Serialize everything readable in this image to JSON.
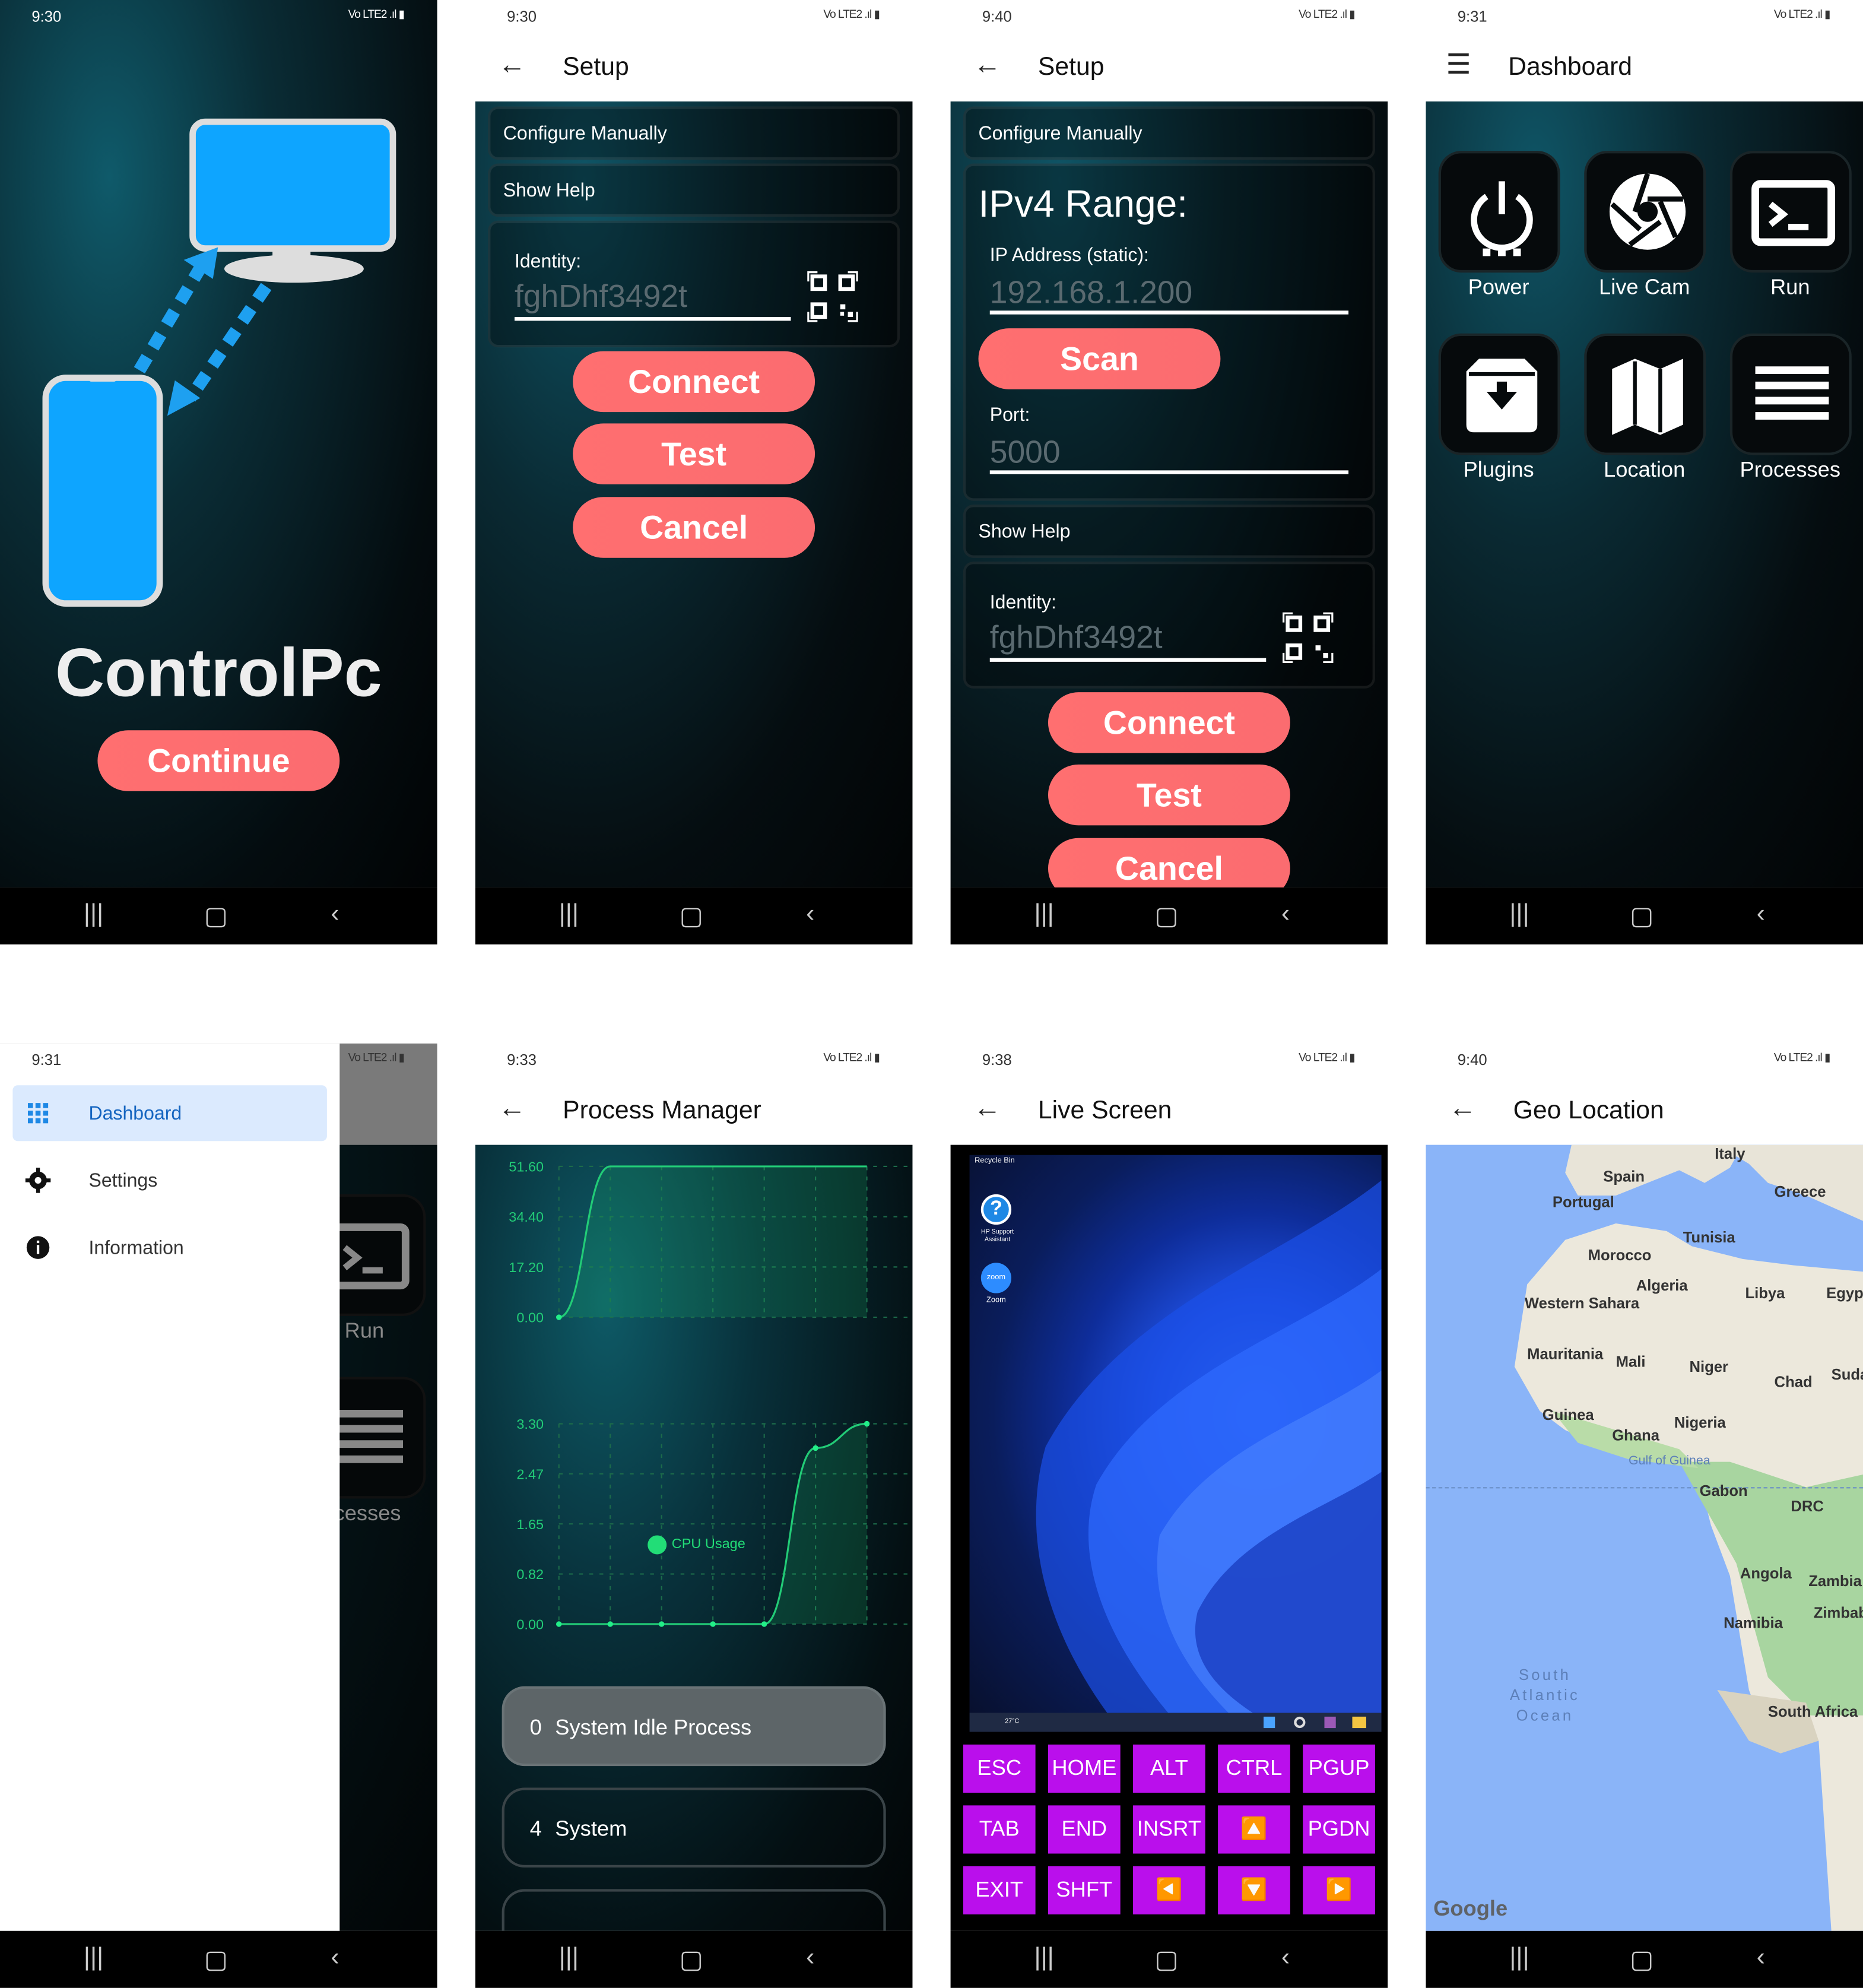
{
  "status_bar": {
    "icons": "Vo LTE2 .ıl ▮",
    "times": [
      "9:30",
      "9:30",
      "9:40",
      "9:31",
      "9:31",
      "9:33",
      "9:38",
      "9:40"
    ]
  },
  "nav_bar": {
    "recent": "|||",
    "home": "▢",
    "back": "‹"
  },
  "splash": {
    "app_name": "ControlPc",
    "continue_label": "Continue",
    "colors": {
      "device_blue": "#0ea5ff",
      "button": "#fb6c70"
    }
  },
  "setup": {
    "title": "Setup",
    "configure_manually": "Configure Manually",
    "show_help": "Show Help",
    "identity_label": "Identity:",
    "identity_value": "fghDhf3492t",
    "connect_label": "Connect",
    "test_label": "Test",
    "cancel_label": "Cancel",
    "ipv4_heading": "IPv4 Range:",
    "ip_label": "IP Address (static):",
    "ip_value": "192.168.1.200",
    "scan_label": "Scan",
    "port_label": "Port:",
    "port_value": "5000"
  },
  "dashboard": {
    "title": "Dashboard",
    "tiles": [
      {
        "label": "Power",
        "icon": "power-icon"
      },
      {
        "label": "Live Cam",
        "icon": "camera-aperture-icon"
      },
      {
        "label": "Run",
        "icon": "terminal-icon"
      },
      {
        "label": "Plugins",
        "icon": "archive-download-icon"
      },
      {
        "label": "Location",
        "icon": "map-icon"
      },
      {
        "label": "Processes",
        "icon": "list-lines-icon"
      }
    ]
  },
  "drawer": {
    "items": [
      {
        "label": "Dashboard",
        "icon": "grid-icon",
        "selected": true
      },
      {
        "label": "Settings",
        "icon": "gear-icon",
        "selected": false
      },
      {
        "label": "Information",
        "icon": "info-icon",
        "selected": false
      }
    ],
    "background_labels": {
      "run": "Run",
      "processes": "ocesses"
    }
  },
  "process_manager": {
    "title": "Process Manager",
    "legend": "CPU Usage",
    "processes": [
      {
        "pid": "0",
        "name": "System Idle Process"
      },
      {
        "pid": "4",
        "name": "System"
      }
    ]
  },
  "chart_data": [
    {
      "type": "line",
      "yticks": [
        "51.60",
        "34.40",
        "17.20",
        "0.00"
      ],
      "ylim": [
        0,
        51.6
      ],
      "series": [
        {
          "values": [
            0,
            51.6,
            51.6,
            51.6,
            51.6,
            51.6,
            51.6
          ]
        }
      ],
      "grid": true
    },
    {
      "type": "line",
      "yticks": [
        "3.30",
        "2.47",
        "1.65",
        "0.82",
        "0.00"
      ],
      "ylim": [
        0,
        3.3
      ],
      "series": [
        {
          "name": "CPU Usage",
          "values": [
            0,
            0,
            0,
            0,
            0,
            2.9,
            3.3
          ]
        }
      ],
      "legend": "center-top",
      "grid": true
    }
  ],
  "live_screen": {
    "title": "Live Screen",
    "desktop": {
      "recycle_bin": "Recycle Bin",
      "hp_support": "HP Support Assistant",
      "zoom": "Zoom",
      "weather": "27°C"
    },
    "keys": [
      [
        "ESC",
        "HOME",
        "ALT",
        "CTRL",
        "PGUP"
      ],
      [
        "TAB",
        "END",
        "INSRT",
        "🔼",
        "PGDN"
      ],
      [
        "EXIT",
        "SHFT",
        "◀️",
        "🔽",
        "▶️"
      ]
    ],
    "key_color": "#ba0fec"
  },
  "geo_location": {
    "title": "Geo Location",
    "labels": [
      "Italy",
      "Spain",
      "Portugal",
      "Greece",
      "Tunisia",
      "Morocco",
      "Algeria",
      "Libya",
      "Egyp",
      "Western Sahara",
      "Mauritania",
      "Mali",
      "Niger",
      "Chad",
      "Suda",
      "Guinea",
      "Nigeria",
      "Ghana",
      "Gulf of Guinea",
      "Gabon",
      "DRC",
      "Angola",
      "Zambia",
      "Namibia",
      "Zimbab",
      "South Africa",
      "South Atlantic Ocean"
    ],
    "attribution": "Google"
  }
}
